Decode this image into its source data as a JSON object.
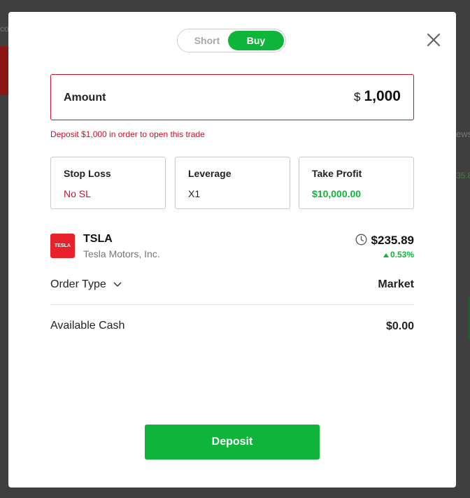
{
  "trade_modal": {
    "direction_toggle": {
      "short_label": "Short",
      "buy_label": "Buy",
      "selected": "Buy"
    },
    "amount": {
      "label": "Amount",
      "currency": "$",
      "value": "1,000"
    },
    "warning": "Deposit $1,000 in order to open this trade",
    "params": [
      {
        "label": "Stop Loss",
        "value": "No SL"
      },
      {
        "label": "Leverage",
        "value": "X1"
      },
      {
        "label": "Take Profit",
        "value": "$10,000.00"
      }
    ],
    "instrument": {
      "logo_text": "TESLA",
      "ticker": "TSLA",
      "company": "Tesla Motors, Inc.",
      "price": "$235.89",
      "change": "0.53%"
    },
    "order_type": {
      "label": "Order Type",
      "value": "Market"
    },
    "available_cash": {
      "label": "Available Cash",
      "value": "$0.00"
    },
    "deposit_label": "Deposit"
  },
  "colors": {
    "accent_green": "#0fb53a",
    "error_red": "#c8102e",
    "brand_tesla": "#e8222c"
  },
  "background_page": {
    "left_fragment": "co",
    "right_fragment": "ews",
    "right_value_fragment": "35.8"
  }
}
